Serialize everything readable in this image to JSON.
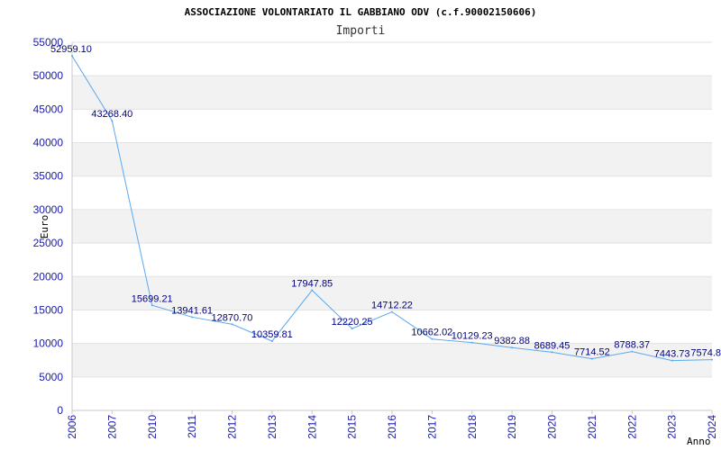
{
  "chart_data": {
    "type": "line",
    "title": "ASSOCIAZIONE VOLONTARIATO IL GABBIANO ODV (c.f.90002150606)",
    "subtitle": "Importi",
    "xlabel": "Anno",
    "ylabel": "Euro",
    "ylim": [
      0,
      55000
    ],
    "yticks": [
      0,
      5000,
      10000,
      15000,
      20000,
      25000,
      30000,
      35000,
      40000,
      45000,
      50000,
      55000
    ],
    "grid": "horizontal alternating bands",
    "x": [
      "2006",
      "2007",
      "2010",
      "2011",
      "2012",
      "2013",
      "2014",
      "2015",
      "2016",
      "2017",
      "2018",
      "2019",
      "2020",
      "2021",
      "2022",
      "2023",
      "2024"
    ],
    "values": [
      52959.1,
      43268.4,
      15699.21,
      13941.61,
      12870.7,
      10359.81,
      17947.85,
      12220.25,
      14712.22,
      10662.02,
      10129.23,
      9382.88,
      8689.45,
      7714.52,
      8788.37,
      7443.73,
      7574.8
    ],
    "data_labels": [
      "52959.10",
      "43268.40",
      "15699.21",
      "13941.61",
      "12870.70",
      "10359.81",
      "17947.85",
      "12220.25",
      "14712.22",
      "10662.02",
      "10129.23",
      "9382.88",
      "8689.45",
      "7714.52",
      "8788.37",
      "7443.73",
      "7574.8"
    ],
    "line_color": "#5aa9f0",
    "band_color": "#f2f2f2",
    "tick_color": "#1a1aa6",
    "label_color": "#000080"
  }
}
